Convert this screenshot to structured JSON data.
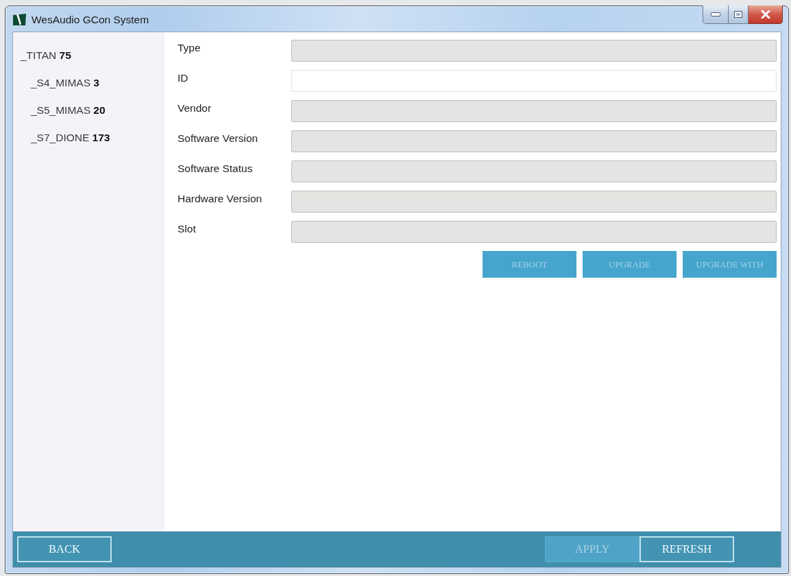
{
  "window": {
    "title": "WesAudio GCon System"
  },
  "tree": [
    {
      "label": "_TITAN **75**",
      "children": [
        {
          "label": "_S4_MIMAS **3**"
        },
        {
          "label": "_S5_MIMAS **20**"
        },
        {
          "label": "_S7_DIONE **173**"
        }
      ]
    }
  ],
  "fields": [
    {
      "label": "Type",
      "disabled": true
    },
    {
      "label": "ID",
      "disabled": false
    },
    {
      "label": "Vendor",
      "disabled": true
    },
    {
      "label": "Software Version",
      "disabled": true
    },
    {
      "label": "Software Status",
      "disabled": true
    },
    {
      "label": "Hardware Version",
      "disabled": true
    },
    {
      "label": "Slot",
      "disabled": true
    }
  ],
  "actions": [
    {
      "label": "REBOOT",
      "disabled": true
    },
    {
      "label": "UPGRADE",
      "disabled": true
    },
    {
      "label": "UPGRADE WITH",
      "disabled": true
    }
  ],
  "footer": {
    "left": [
      {
        "label": "BACK",
        "disabled": false
      }
    ],
    "right": [
      {
        "label": "APPLY",
        "disabled": true
      },
      {
        "label": "REFRESH",
        "disabled": false
      }
    ]
  }
}
